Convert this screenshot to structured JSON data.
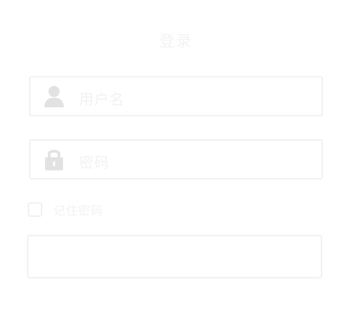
{
  "login": {
    "title": "登录",
    "username_placeholder": "用户名",
    "password_placeholder": "密码",
    "remember_label": "记住密码",
    "submit_label": ""
  },
  "icons": {
    "username": "user-icon",
    "password": "lock-icon"
  },
  "colors": {
    "background": "#ffffff",
    "border": "#f1f1f1",
    "text": "#f2f2f2",
    "icon": "#e2e2e2"
  }
}
